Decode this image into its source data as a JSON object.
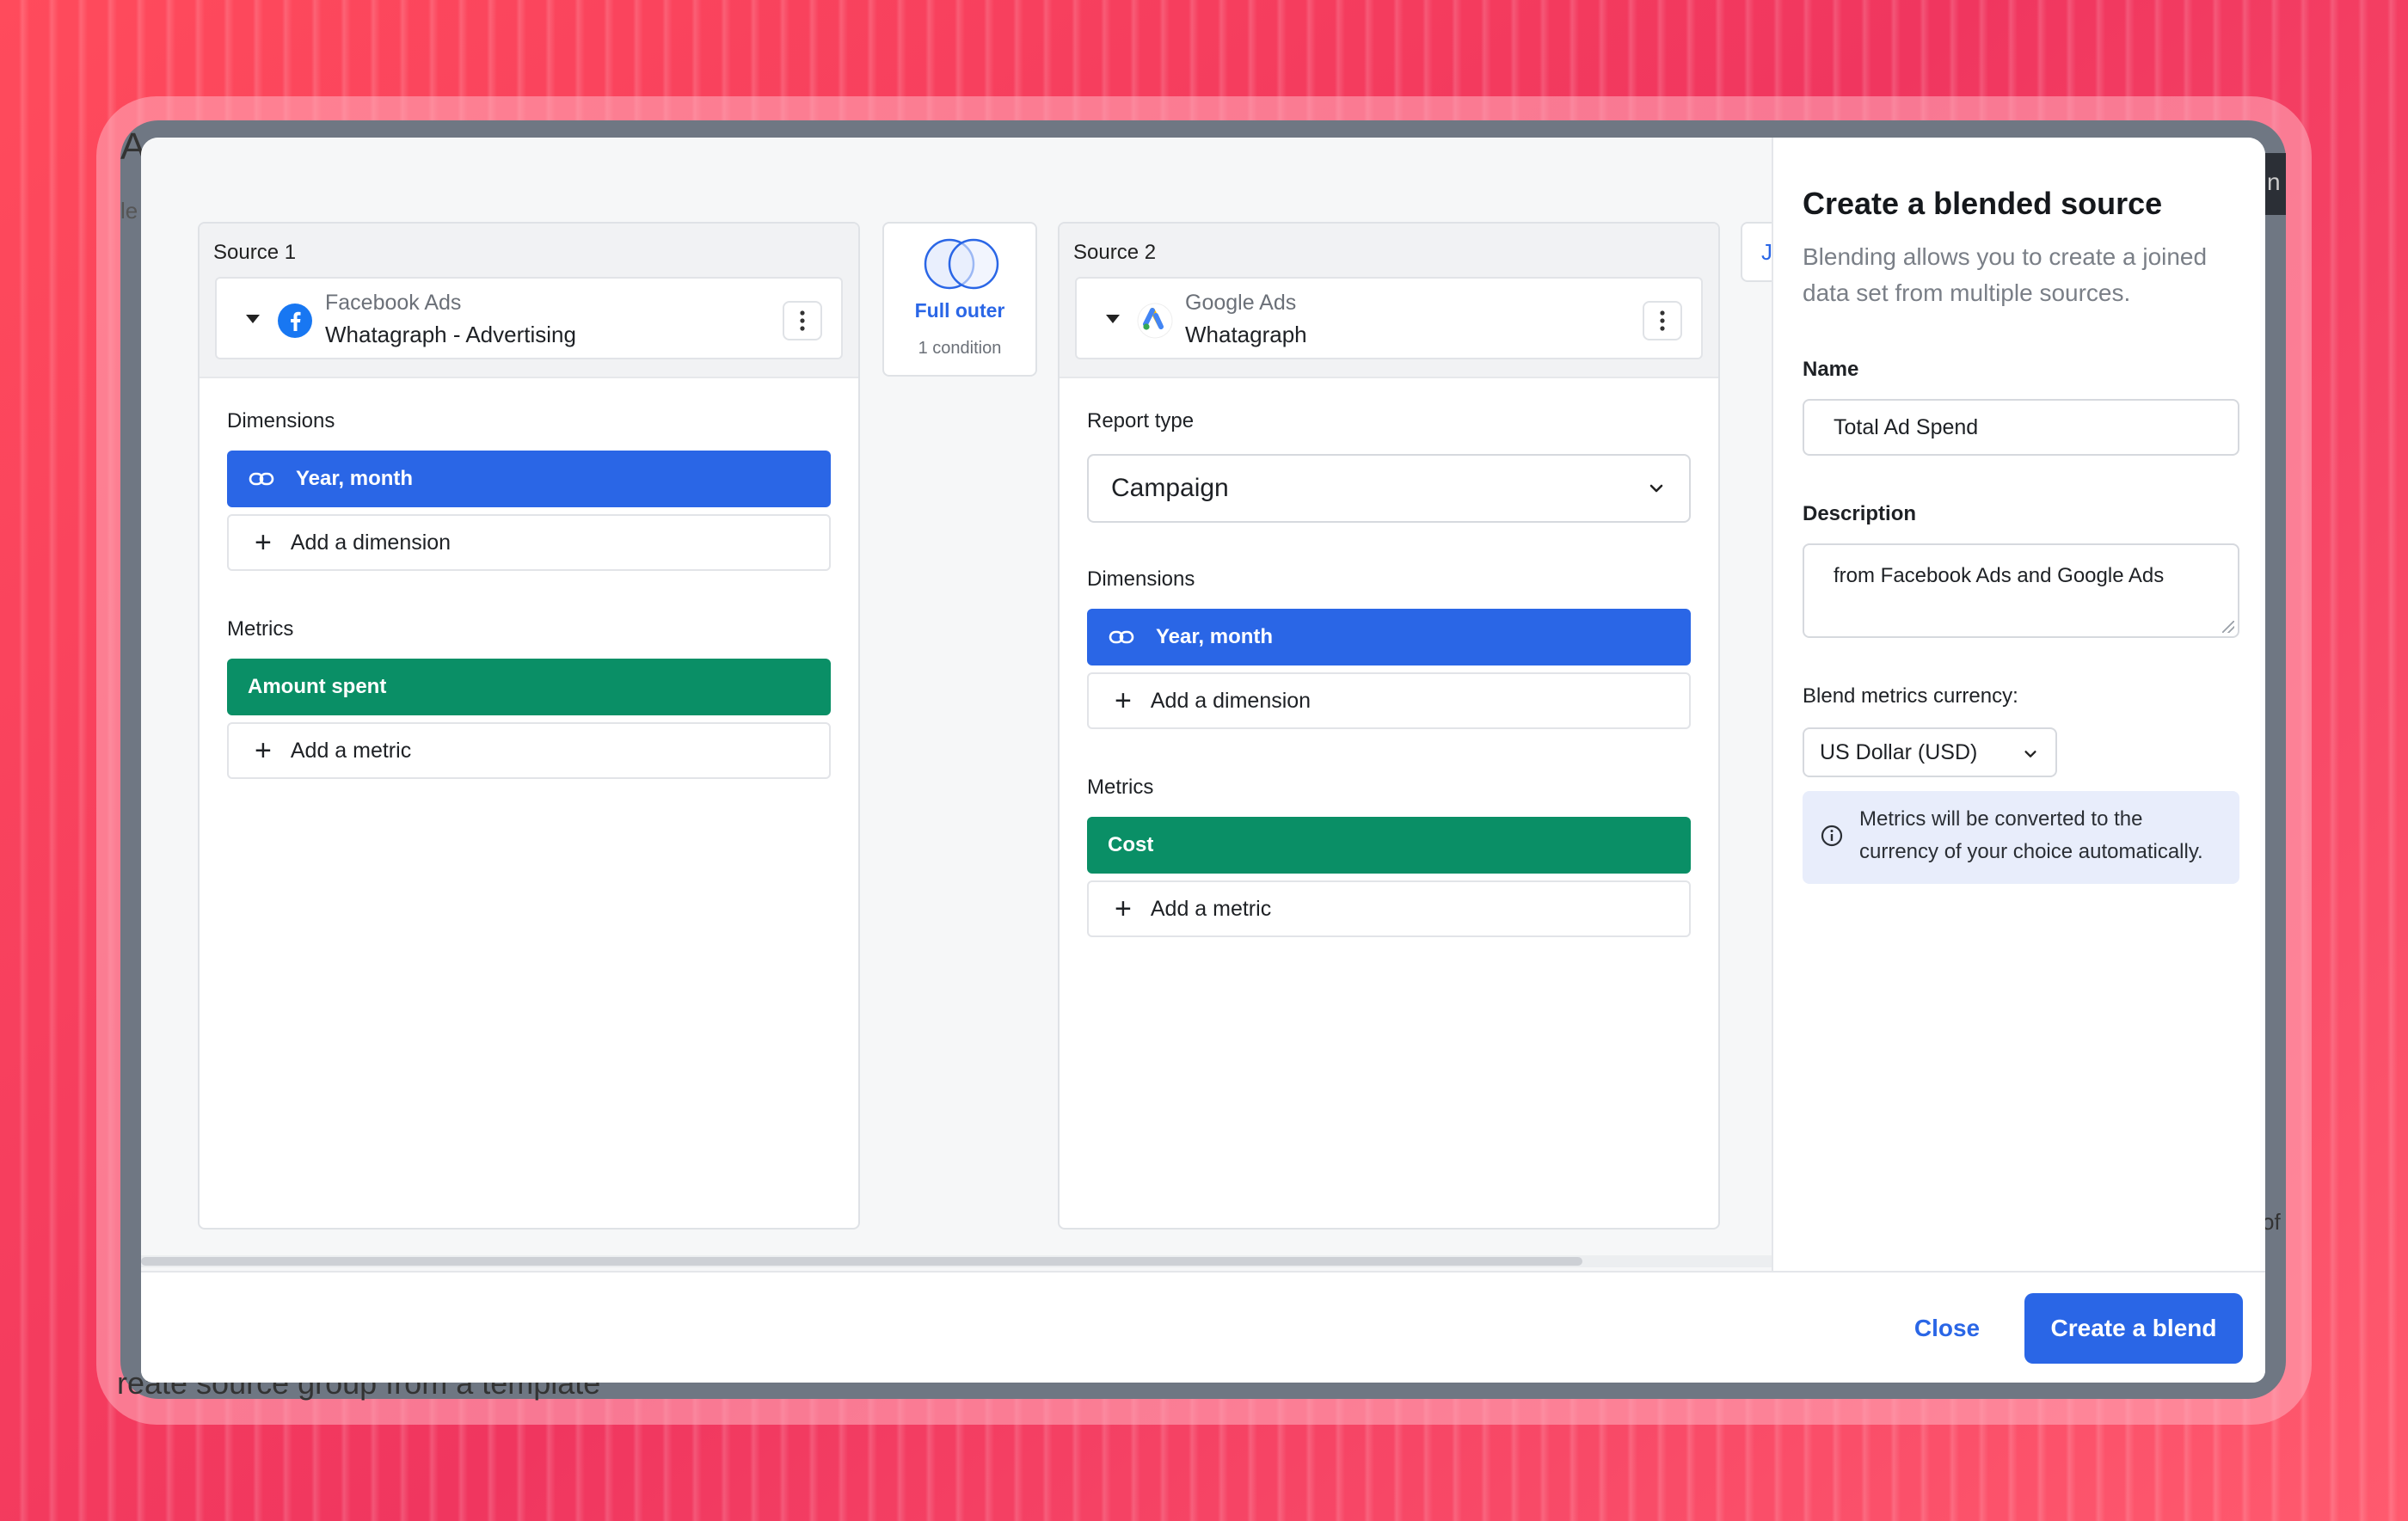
{
  "background": {
    "behind_modal_text": "reate source group from a template",
    "right_edge_text": "of",
    "left_peek_text": "A",
    "left_peek_sub": "le",
    "right_peek_text": "n"
  },
  "source1": {
    "title": "Source 1",
    "platform": "Facebook Ads",
    "account": "Whatagraph - Advertising",
    "dimensions_label": "Dimensions",
    "dimension_pill": "Year, month",
    "add_dimension": "Add a dimension",
    "metrics_label": "Metrics",
    "metric_pill": "Amount spent",
    "add_metric": "Add a metric"
  },
  "join": {
    "label": "Full outer",
    "conditions": "1 condition"
  },
  "source2": {
    "title": "Source 2",
    "platform": "Google Ads",
    "account": "Whatagraph",
    "report_type_label": "Report type",
    "report_type_value": "Campaign",
    "dimensions_label": "Dimensions",
    "dimension_pill": "Year, month",
    "add_dimension": "Add a dimension",
    "metrics_label": "Metrics",
    "metric_pill": "Cost",
    "add_metric": "Add a metric"
  },
  "partial_card_letter": "J",
  "sidebar": {
    "title": "Create a blended source",
    "description": "Blending allows you to create a joined data set from multiple sources.",
    "name_label": "Name",
    "name_value": "Total Ad Spend",
    "description_label": "Description",
    "description_value": "from Facebook Ads and Google Ads",
    "currency_label": "Blend metrics currency:",
    "currency_value": "US Dollar (USD)",
    "info_text": "Metrics will be converted to the currency of your choice automatically."
  },
  "footer": {
    "close_label": "Close",
    "create_label": "Create a blend"
  },
  "colors": {
    "primary": "#2a66e6",
    "metric_green": "#0a8f66",
    "background_red": "#f0365f"
  }
}
